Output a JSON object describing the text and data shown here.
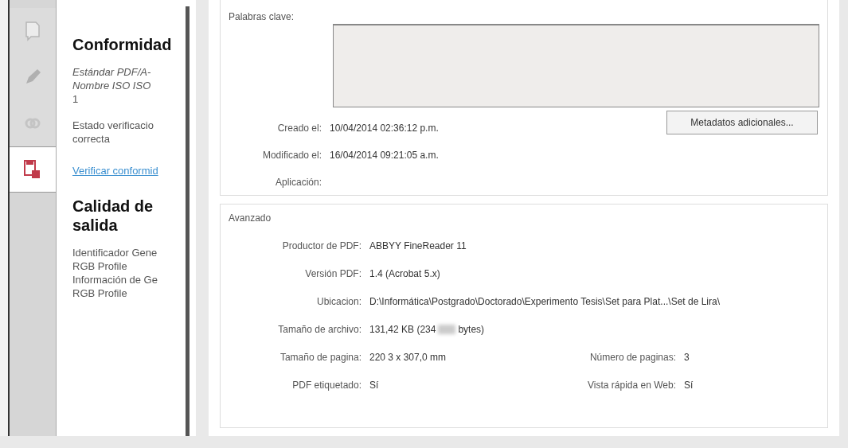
{
  "side_tabs": [
    {
      "selected": false
    },
    {
      "selected": false
    },
    {
      "selected": false
    },
    {
      "selected": true
    }
  ],
  "side_panel": {
    "sections": [
      {
        "heading": "Conformidad",
        "lines": [
          {
            "text": "Estándar PDF/A-",
            "italic": true
          },
          {
            "text": "Nombre ISO ISO",
            "italic": true
          },
          {
            "text": "1",
            "italic": false
          }
        ],
        "status": [
          "Estado verificacio",
          "correcta"
        ],
        "link": "Verificar conformid"
      },
      {
        "heading": "Calidad de salida",
        "lines": [
          {
            "text": "Identificador Gene",
            "italic": false
          },
          {
            "text": "RGB Profile",
            "italic": false
          },
          {
            "text": "Información de Ge",
            "italic": false
          },
          {
            "text": "RGB Profile",
            "italic": false
          }
        ]
      }
    ]
  },
  "description": {
    "keywords_label": "Palabras clave:",
    "rows": [
      {
        "label": "Creado el:",
        "value": "10/04/2014 02:36:12 p.m."
      },
      {
        "label": "Modificado el:",
        "value": "16/04/2014 09:21:05 a.m."
      },
      {
        "label": "Aplicación:",
        "value": ""
      }
    ],
    "button": "Metadatos adicionales..."
  },
  "advanced": {
    "title": "Avanzado",
    "rows": [
      {
        "label": "Productor de PDF:",
        "value": "ABBYY FineReader 11"
      },
      {
        "label": "Versión PDF:",
        "value": "1.4 (Acrobat 5.x)"
      },
      {
        "label": "Ubicacion:",
        "value": "D:\\Informática\\Postgrado\\Doctorado\\Experimento Tesis\\Set para Plat...\\Set de Lira\\"
      },
      {
        "label": "Tamaño de archivo:",
        "value": "131,42 KB (234",
        "value_end": "bytes)"
      },
      {
        "label": "Tamaño de pagina:",
        "value": "220 3 x 307,0 mm",
        "label2": "Número de paginas:",
        "value2": "3"
      },
      {
        "label": "PDF etiquetado:",
        "value": "Sí",
        "label2": "Vista rápida en Web:",
        "value2": "Sí"
      }
    ]
  }
}
